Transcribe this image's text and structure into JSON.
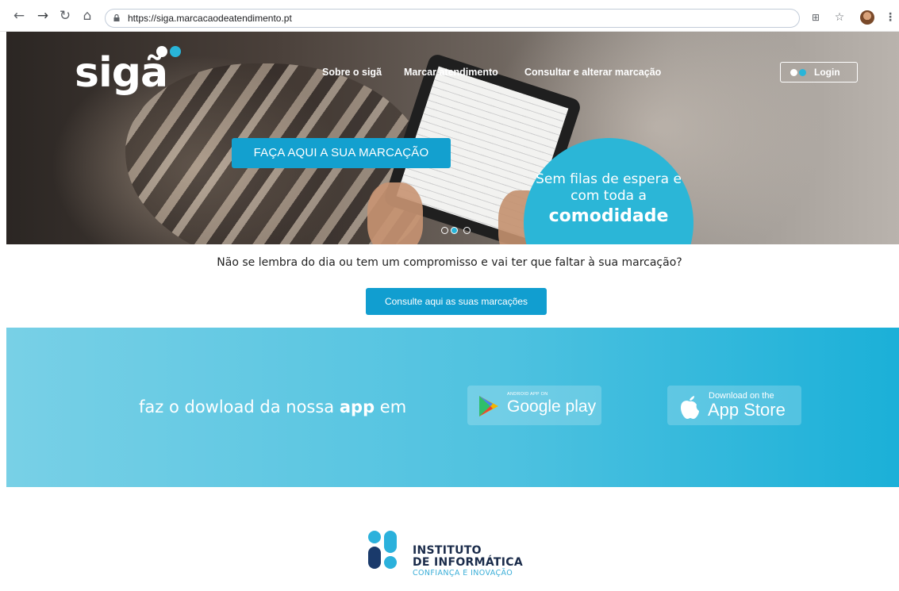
{
  "browser": {
    "url": "https://siga.marcacaodeatendimento.pt",
    "back_icon": "arrow-left-icon",
    "forward_icon": "arrow-right-icon",
    "reload_icon": "reload-icon",
    "home_icon": "home-icon"
  },
  "header": {
    "logo_text": "sigã",
    "nav": [
      {
        "label": "Sobre o sigã"
      },
      {
        "label": "Marcar atendimento"
      },
      {
        "label": "Consultar e alterar marcação"
      }
    ],
    "login_label": "Login"
  },
  "hero": {
    "cta_label": "FAÇA AQUI A SUA MARCAÇÃO",
    "badge_line1": "Sem filas de espera e com toda a",
    "badge_line2": "comodidade",
    "carousel_active": 2,
    "carousel_count": 3
  },
  "middle": {
    "question": "Não se lembra do dia ou tem um compromisso e vai ter que faltar à sua marcação?",
    "consult_label": "Consulte aqui as suas marcações"
  },
  "app": {
    "text_before": "faz o dowload da nossa ",
    "text_bold": "app",
    "text_after": " em",
    "google_small": "ANDROID APP ON",
    "google_big": "Google play",
    "apple_small": "Download on the",
    "apple_big": "App Store"
  },
  "footer": {
    "org_line1": "INSTITUTO",
    "org_line2": "DE INFORMÁTICA",
    "org_tagline": "CONFIANÇA E INOVAÇÃO"
  },
  "colors": {
    "accent": "#13a0cf",
    "badge": "#2bb6d7",
    "band_start": "#78d0e6",
    "band_end": "#1bb0d8"
  }
}
